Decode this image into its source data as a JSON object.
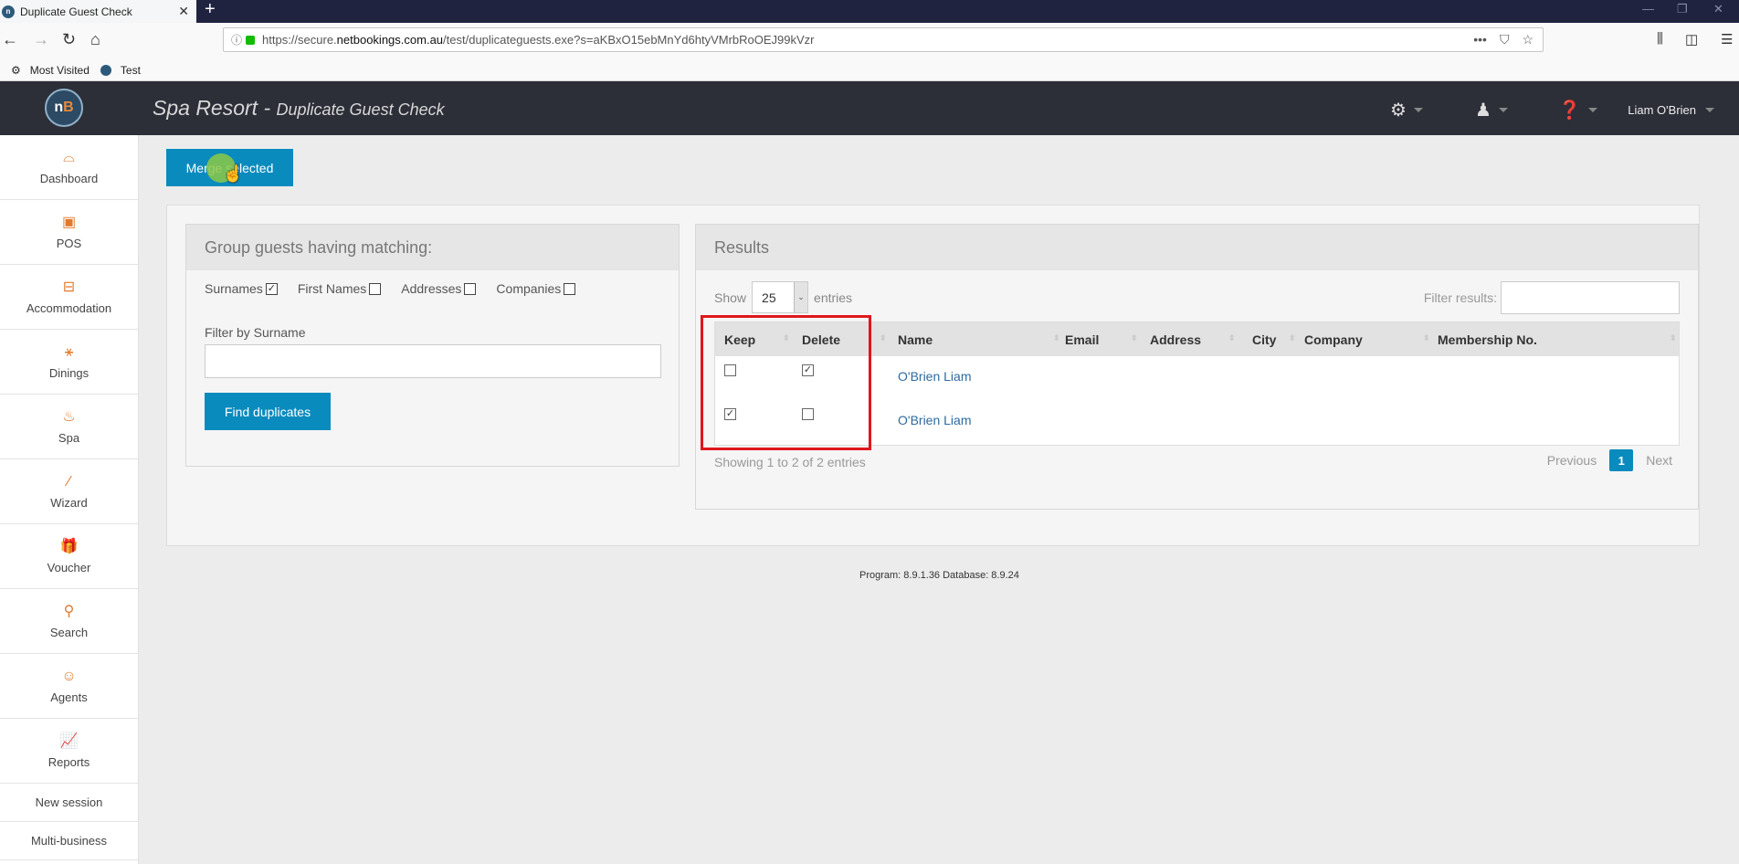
{
  "browser": {
    "tab_title": "Duplicate Guest Check",
    "tab_close": "✕",
    "new_tab": "+",
    "url_scheme": "https://secure.",
    "url_host": "netbookings.com.au",
    "url_path": "/test/duplicateguests.exe?s=aKBxO15ebMnYd6htyVMrbRoOEJ99kVzr",
    "bookmarks": [
      {
        "label": "Most Visited",
        "icon": "gear-icon"
      },
      {
        "label": "Test",
        "icon": "favicon"
      }
    ],
    "window_controls": [
      "—",
      "❐",
      "✕"
    ]
  },
  "header": {
    "logo_n": "n",
    "logo_b": "B",
    "title": "Spa Resort - ",
    "subtitle": "Duplicate Guest Check",
    "user": "Liam O'Brien"
  },
  "sidebar": {
    "items": [
      {
        "label": "Dashboard",
        "icon": "⌓"
      },
      {
        "label": "POS",
        "icon": "▣"
      },
      {
        "label": "Accommodation",
        "icon": "⊟"
      },
      {
        "label": "Dinings",
        "icon": "⚹"
      },
      {
        "label": "Spa",
        "icon": "♨"
      },
      {
        "label": "Wizard",
        "icon": "⁄"
      },
      {
        "label": "Voucher",
        "icon": "🎁"
      },
      {
        "label": "Search",
        "icon": "⚲"
      },
      {
        "label": "Agents",
        "icon": "☺"
      },
      {
        "label": "Reports",
        "icon": "📈"
      }
    ],
    "links": [
      "New session",
      "Multi-business"
    ]
  },
  "main": {
    "merge_button": "Merge selected",
    "group_panel": {
      "title": "Group guests having matching:",
      "options": [
        {
          "label": "Surnames",
          "checked": true
        },
        {
          "label": "First Names",
          "checked": false
        },
        {
          "label": "Addresses",
          "checked": false
        },
        {
          "label": "Companies",
          "checked": false
        }
      ],
      "filter_label": "Filter by Surname",
      "filter_value": "",
      "find_button": "Find duplicates"
    },
    "results": {
      "title": "Results",
      "show_label": "Show",
      "entries_label": "entries",
      "page_size": "25",
      "filter_label": "Filter results:",
      "filter_value": "",
      "columns": [
        "Keep",
        "Delete",
        "Name",
        "Email",
        "Address",
        "City",
        "Company",
        "Membership No."
      ],
      "rows": [
        {
          "keep": false,
          "delete": true,
          "name": "O'Brien Liam",
          "email": "",
          "address": "",
          "city": "",
          "company": "",
          "membership": ""
        },
        {
          "keep": true,
          "delete": false,
          "name": "O'Brien Liam",
          "email": "",
          "address": "",
          "city": "",
          "company": "",
          "membership": ""
        }
      ],
      "info": "Showing 1 to 2 of 2 entries",
      "previous": "Previous",
      "current_page": "1",
      "next": "Next"
    },
    "footer": "Program: 8.9.1.36 Database: 8.9.24"
  },
  "colors": {
    "primary": "#0a8bbd",
    "accent_orange": "#e07a2e",
    "header_bg": "#2c2e38",
    "highlight": "#e0161c",
    "link": "#2d6aa0"
  }
}
